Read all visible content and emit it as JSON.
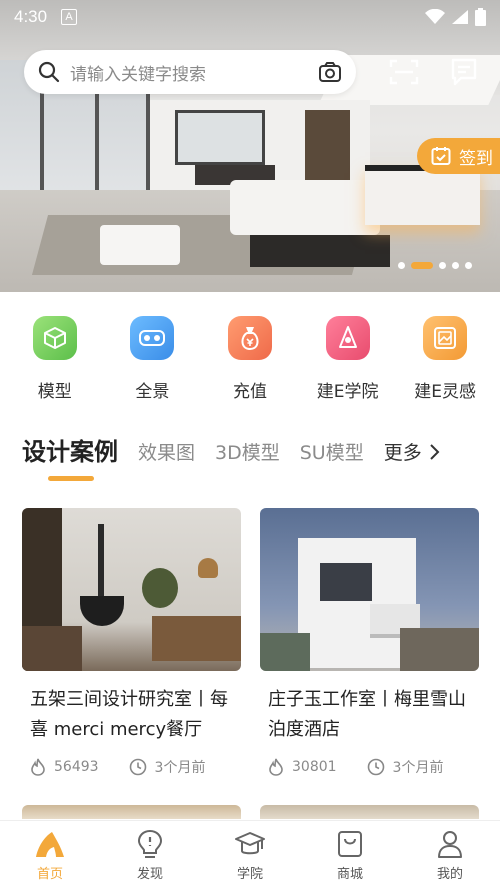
{
  "status_bar": {
    "time": "4:30",
    "badge": "A"
  },
  "search": {
    "placeholder": "请输入关键字搜索"
  },
  "hero": {
    "checkin_label": "签到",
    "slides": 5,
    "active_slide": 1
  },
  "categories": [
    {
      "label": "模型",
      "icon": "cube-icon",
      "color": "#7ccf5c"
    },
    {
      "label": "全景",
      "icon": "vr-glasses-icon",
      "color": "#4fa3f0"
    },
    {
      "label": "充值",
      "icon": "money-bag-icon",
      "color": "#f47e5a"
    },
    {
      "label": "建E学院",
      "icon": "academy-icon",
      "color": "#f06080"
    },
    {
      "label": "建E灵感",
      "icon": "inspiration-icon",
      "color": "#f5a742"
    }
  ],
  "tabs": [
    {
      "label": "设计案例",
      "active": true
    },
    {
      "label": "效果图",
      "active": false
    },
    {
      "label": "3D模型",
      "active": false
    },
    {
      "label": "SU模型",
      "active": false
    }
  ],
  "more_label": "更多",
  "cards": [
    {
      "title": "五架三间设计研究室丨每喜 merci mercy餐厅",
      "views": "56493",
      "time": "3个月前"
    },
    {
      "title": "庄子玉工作室丨梅里雪山泊度酒店",
      "views": "30801",
      "time": "3个月前"
    }
  ],
  "bottom_nav": [
    {
      "label": "首页",
      "icon": "home-icon",
      "active": true
    },
    {
      "label": "发现",
      "icon": "lightbulb-icon",
      "active": false
    },
    {
      "label": "学院",
      "icon": "graduation-cap-icon",
      "active": false
    },
    {
      "label": "商城",
      "icon": "shopping-bag-icon",
      "active": false
    },
    {
      "label": "我的",
      "icon": "user-icon",
      "active": false
    }
  ],
  "colors": {
    "accent": "#f3a83a"
  }
}
